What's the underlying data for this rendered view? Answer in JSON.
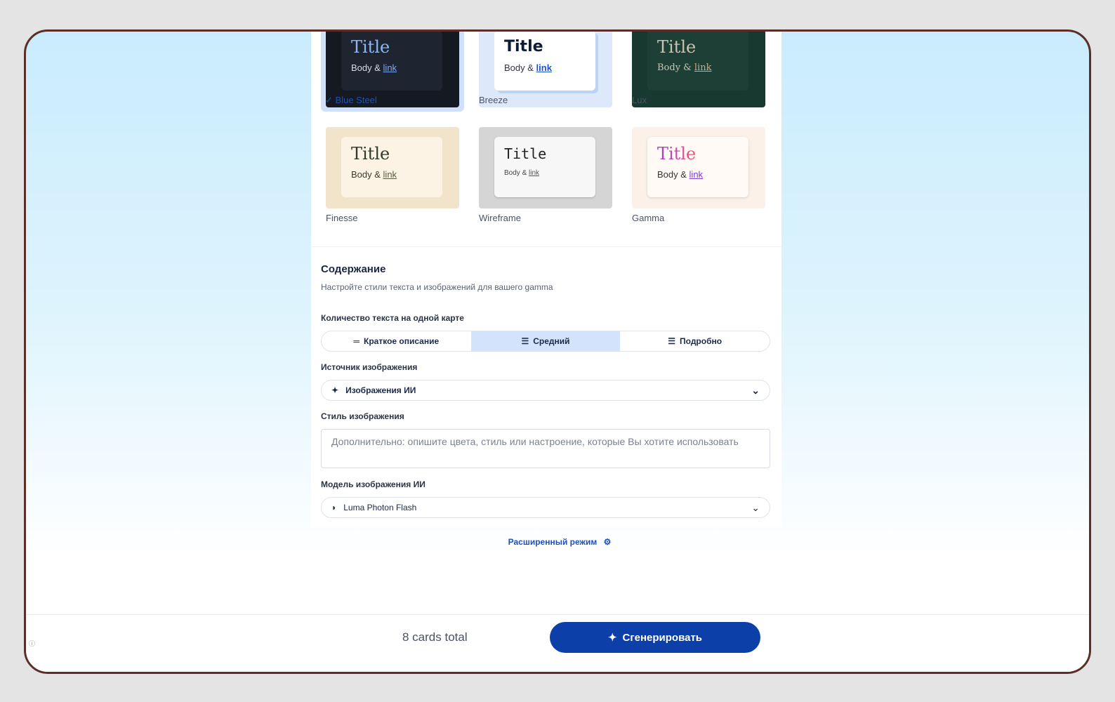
{
  "themes": [
    {
      "name": "Blue Steel",
      "title": "Title",
      "body": "Body &",
      "link": "link",
      "selected": true
    },
    {
      "name": "Breeze",
      "title": "Title",
      "body": "Body &",
      "link": "link"
    },
    {
      "name": "Lux",
      "title": "Title",
      "body": "Body &",
      "link": "link"
    },
    {
      "name": "Finesse",
      "title": "Title",
      "body": "Body &",
      "link": "link"
    },
    {
      "name": "Wireframe",
      "title": "Title",
      "body": "Body &",
      "link": "link"
    },
    {
      "name": "Gamma",
      "title": "Title",
      "body": "Body &",
      "link": "link"
    }
  ],
  "content": {
    "title": "Содержание",
    "subtitle": "Настройте стили текста и изображений для вашего gamma",
    "text_amount_label": "Количество текста на одной карте",
    "text_amount_options": [
      "Краткое описание",
      "Средний",
      "Подробно"
    ],
    "text_amount_selected": "Средний",
    "image_source_label": "Источник изображения",
    "image_source_value": "Изображения ИИ",
    "image_style_label": "Стиль изображения",
    "image_style_placeholder": "Дополнительно: опишите цвета, стиль или настроение, которые Вы хотите использовать",
    "image_model_label": "Модель изображения ИИ",
    "image_model_value": "Luma Photon Flash"
  },
  "advanced_mode": "Расширенный режим",
  "footer": {
    "total": "8 cards total",
    "generate": "Сгенерировать"
  },
  "colors": {
    "accent": "#0d3fa8",
    "selected_bg": "#cfe0fc"
  }
}
